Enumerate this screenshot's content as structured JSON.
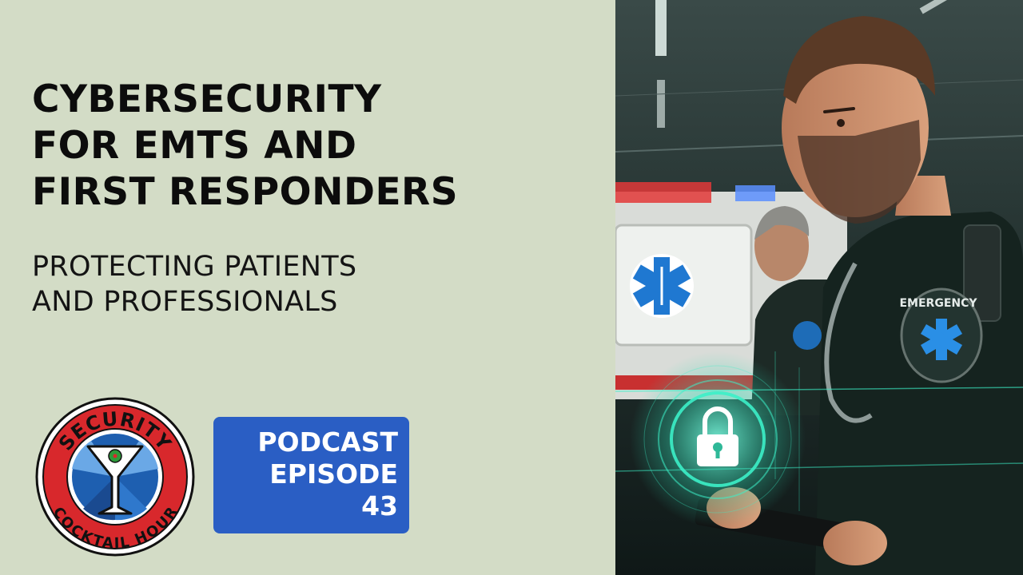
{
  "title": {
    "line1": "CYBERSECURITY",
    "line2": "FOR EMTS AND",
    "line3": "FIRST RESPONDERS"
  },
  "subtitle": {
    "line1": "PROTECTING PATIENTS",
    "line2": "AND PROFESSIONALS"
  },
  "logo": {
    "top_text": "SECURITY",
    "bottom_text": "COCKTAIL HOUR"
  },
  "badge": {
    "line1": "PODCAST",
    "line2": "EPISODE",
    "line3": "43"
  },
  "photo": {
    "patch_text": "EMERGENCY"
  },
  "colors": {
    "background": "#d3dcc6",
    "badge": "#2a5ec4",
    "logo_red": "#d8282c",
    "logo_blue": "#1e5fb0",
    "glow": "#3cf0c8"
  }
}
